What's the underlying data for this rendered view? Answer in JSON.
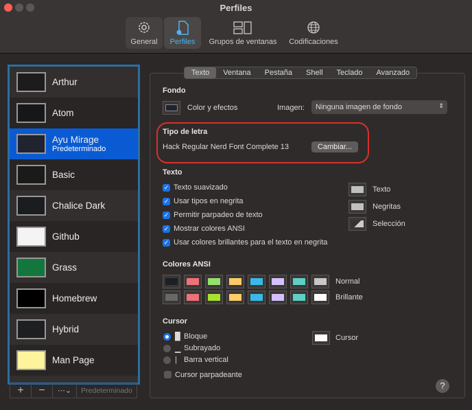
{
  "window": {
    "title": "Perfiles"
  },
  "toolbar": [
    {
      "label": "General",
      "icon": "gear-icon"
    },
    {
      "label": "Perfiles",
      "icon": "profile-icon"
    },
    {
      "label": "Grupos de ventanas",
      "icon": "window-groups-icon"
    },
    {
      "label": "Codificaciones",
      "icon": "globe-icon"
    }
  ],
  "profiles": [
    {
      "name": "Arthur",
      "bg": "#1c1c1c"
    },
    {
      "name": "Atom",
      "bg": "#161719"
    },
    {
      "name": "Ayu Mirage",
      "sub": "Predeterminado",
      "bg": "#1f2430"
    },
    {
      "name": "Basic",
      "bg": "#1a1a1a"
    },
    {
      "name": "Chalice Dark",
      "bg": "#1a1d1f"
    },
    {
      "name": "Github",
      "bg": "#f4f4f4"
    },
    {
      "name": "Grass",
      "bg": "#13773d"
    },
    {
      "name": "Homebrew",
      "bg": "#000000"
    },
    {
      "name": "Hybrid",
      "bg": "#1d1f21"
    },
    {
      "name": "Man Page",
      "bg": "#fef49c"
    }
  ],
  "bottombar": {
    "add": "+",
    "remove": "−",
    "more": "⋯⌄",
    "default": "Predeterminado"
  },
  "tabs": [
    "Texto",
    "Ventana",
    "Pestaña",
    "Shell",
    "Teclado",
    "Avanzado"
  ],
  "fondo": {
    "heading": "Fondo",
    "color_label": "Color y efectos",
    "image_label": "Imagen:",
    "image_value": "Ninguna imagen de fondo"
  },
  "font": {
    "heading": "Tipo de letra",
    "value": "Hack Regular Nerd Font Complete 13",
    "button": "Cambiar..."
  },
  "text": {
    "heading": "Texto",
    "options": [
      "Texto suavizado",
      "Usar tipos en negrita",
      "Permitir parpadeo de texto",
      "Mostrar colores ANSI",
      "Usar colores brillantes para el texto en negrita"
    ],
    "colors": [
      "Texto",
      "Negritas",
      "Selección"
    ]
  },
  "ansi": {
    "heading": "Colores ANSI",
    "normal_label": "Normal",
    "bright_label": "Brillante",
    "normal": [
      "#1c1f26",
      "#f07178",
      "#95e06c",
      "#ffcc66",
      "#39bae6",
      "#d4bfff",
      "#5ccfc6",
      "#c7c7c7"
    ],
    "bright": [
      "#686868",
      "#f07178",
      "#a6e22e",
      "#ffcc66",
      "#39bae6",
      "#d4bfff",
      "#5ccfc6",
      "#ffffff"
    ]
  },
  "cursor": {
    "heading": "Cursor",
    "options": [
      "Bloque",
      "Subrayado",
      "Barra vertical"
    ],
    "glyphs": [
      "█",
      "▁",
      "|"
    ],
    "selected": 0,
    "color_label": "Cursor",
    "blink": "Cursor parpadeante"
  },
  "help": "?",
  "accent": "#0a5bd3",
  "highlight_color": "#d9302c"
}
